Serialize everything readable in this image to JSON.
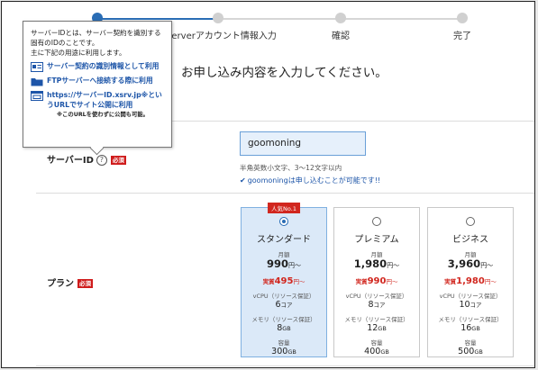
{
  "stepper": {
    "steps": [
      {
        "label": "serverアカウント情報入力"
      },
      {
        "label": "確認"
      },
      {
        "label": "完了"
      }
    ]
  },
  "lead_text": "お申し込み内容を入力してください。",
  "tooltip": {
    "desc_lines": [
      "サーバーIDとは、サーバー契約を識別する",
      "固有のIDのことです。",
      "主に下記の用途に利用します。"
    ],
    "items": [
      {
        "icon": "id-card-icon",
        "text": "サーバー契約の識別情報として利用"
      },
      {
        "icon": "folder-icon",
        "text": "FTPサーバーへ接続する際に利用"
      },
      {
        "icon": "browser-icon",
        "text": "https://サーバーID.xsrv.jp※というURLでサイト公開に利用"
      }
    ],
    "note": "※このURLを使わずに公開も可能。"
  },
  "server_id": {
    "label": "サーバーID",
    "required": "必須",
    "value": "goomoning",
    "hint": "半角英数小文字、3〜12文字以内",
    "ok_message": "goomoningは申し込むことが可能です!!"
  },
  "plan": {
    "label": "プラン",
    "required": "必須",
    "cards": [
      {
        "name": "スタンダード",
        "badge": "人気No.1",
        "selected": true,
        "monthly_label": "月額",
        "price": "990",
        "real_label": "実質",
        "real_price": "495",
        "yen": "円〜",
        "cpu_label": "vCPU（リソース保証）",
        "cpu": "6",
        "cpu_unit": "コア",
        "mem_label": "メモリ（リソース保証）",
        "mem": "8",
        "mem_unit": "GB",
        "disk_label": "容量",
        "disk": "300",
        "disk_unit": "GB"
      },
      {
        "name": "プレミアム",
        "badge": "",
        "selected": false,
        "monthly_label": "月額",
        "price": "1,980",
        "real_label": "実質",
        "real_price": "990",
        "yen": "円〜",
        "cpu_label": "vCPU（リソース保証）",
        "cpu": "8",
        "cpu_unit": "コア",
        "mem_label": "メモリ（リソース保証）",
        "mem": "12",
        "mem_unit": "GB",
        "disk_label": "容量",
        "disk": "400",
        "disk_unit": "GB"
      },
      {
        "name": "ビジネス",
        "badge": "",
        "selected": false,
        "monthly_label": "月額",
        "price": "3,960",
        "real_label": "実質",
        "real_price": "1,980",
        "yen": "円〜",
        "cpu_label": "vCPU（リソース保証）",
        "cpu": "10",
        "cpu_unit": "コア",
        "mem_label": "メモリ（リソース保証）",
        "mem": "16",
        "mem_unit": "GB",
        "disk_label": "容量",
        "disk": "500",
        "disk_unit": "GB"
      }
    ]
  },
  "colors": {
    "accent": "#2a6db5",
    "required": "#cf1b1b",
    "price_red": "#d1261e",
    "selected_bg": "#dbe9f8"
  }
}
